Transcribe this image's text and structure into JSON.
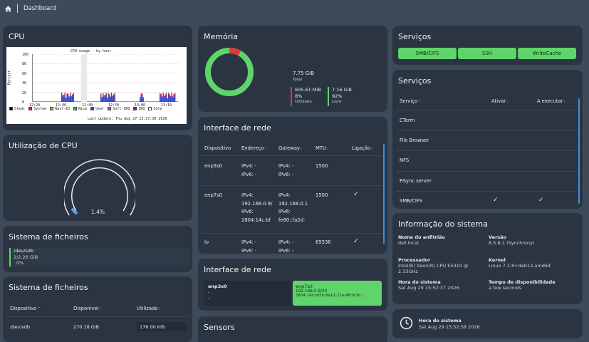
{
  "topbar": {
    "breadcrumb": "Dashboard"
  },
  "cpu": {
    "title": "CPU",
    "graph": {
      "title": "CPU usage - by hour",
      "ylabel": "Percent",
      "yticks": [
        "100",
        "80",
        "60",
        "40",
        "20",
        "0"
      ],
      "xticks": [
        "12:20",
        "12:40",
        "12:40",
        "12:50",
        "13:00",
        "13:10"
      ],
      "legend": [
        "Steal",
        "System",
        "Wait-IO",
        "Nice",
        "User",
        "Soft-IRQ",
        "IRQ",
        "Idle"
      ],
      "legend_colors": [
        "#000000",
        "#e41a1c",
        "#c8a22c",
        "#4daf4a",
        "#2d47d4",
        "#bf4fbf",
        "#6e2a8a",
        "#ffffff"
      ],
      "updated": "Last update: Thu Aug 27 13:17:30 2026"
    }
  },
  "cpu_util": {
    "title": "Utilização de CPU",
    "value": "1.4%",
    "fraction": 0.014
  },
  "fs1": {
    "title": "Sistema de ficheiros",
    "device": "/dev/sdb",
    "usage": "2/2.26 GiB",
    "percent": "0%"
  },
  "fs2": {
    "title": "Sistema de ficheiros",
    "headers": [
      "Dispositivo",
      "Disponível",
      "Utilizado"
    ],
    "row": {
      "device": "/dev/sdb",
      "available": "270.18 GiB",
      "used": "176.00 KiB"
    }
  },
  "memory": {
    "title": "Memória",
    "total_value": "7.75 GiB",
    "total_label": "Total",
    "used_value": "605.61 MiB",
    "used_pct": "8%",
    "used_label": "Utilizado",
    "free_value": "7.16 GiB",
    "free_pct": "92%",
    "free_label": "Livre",
    "used_fraction": 0.08,
    "colors": {
      "used": "#e03a3a",
      "free": "#5fd46b"
    }
  },
  "network": {
    "title": "Interface de rede",
    "headers": [
      "Dispositivo",
      "Endereço",
      "Gateway",
      "MTU",
      "Ligação"
    ],
    "rows": [
      {
        "device": "enp3s0",
        "addr1": "IPv4: -",
        "addr2": "IPv6: -",
        "addr3": "",
        "addr4": "",
        "gw1": "IPv4: -",
        "gw2": "IPv6: -",
        "gw3": "",
        "gw4": "",
        "mtu": "1500",
        "link": ""
      },
      {
        "device": "enp7s0",
        "addr1": "IPv4:",
        "addr2": "192.168.0.9/",
        "addr3": "IPv6:",
        "addr4": "2804:14c:bf",
        "gw1": "IPv4:",
        "gw2": "192.168.0.1",
        "gw3": "IPv6:",
        "gw4": "fe80::fa2d:",
        "mtu": "1500",
        "link": "✓"
      },
      {
        "device": "lo",
        "addr1": "IPv4: -",
        "addr2": "IPv6: -",
        "addr3": "",
        "addr4": "",
        "gw1": "IPv4: -",
        "gw2": "IPv6: -",
        "gw3": "",
        "gw4": "",
        "mtu": "65536",
        "link": "✓"
      }
    ]
  },
  "network2": {
    "title": "Interface de rede",
    "iface1": {
      "name": "enp3s0",
      "line1": "-",
      "line2": "-"
    },
    "iface2": {
      "name": "enp7s0",
      "line1": "192.168.0.9/24",
      "line2": "2804:14c:bf26:8a12:21e:4ff:fe1b..."
    }
  },
  "sensors": {
    "title": "Sensors"
  },
  "services_buttons": {
    "title": "Serviços",
    "buttons": [
      "SMB/CIFS",
      "SSH",
      "WriteCache"
    ]
  },
  "services_table": {
    "title": "Serviços",
    "headers": [
      "Serviço",
      "Ativar",
      "A executar"
    ],
    "rows": [
      {
        "name": "CTerm",
        "enabled": "",
        "running": ""
      },
      {
        "name": "File Browser",
        "enabled": "",
        "running": ""
      },
      {
        "name": "NFS",
        "enabled": "",
        "running": ""
      },
      {
        "name": "RSync server",
        "enabled": "",
        "running": ""
      },
      {
        "name": "SMB/CIFS",
        "enabled": "✓",
        "running": "✓"
      }
    ]
  },
  "sysinfo": {
    "title": "Informação do sistema",
    "hostname_label": "Nome do anfitrião",
    "hostname": "dell.local",
    "version_label": "Versão",
    "version": "8.5.8-1 (Synchrony)",
    "cpu_label": "Processador",
    "cpu": "Intel(R) Xeon(R) CPU E5410 @ 2.33GHz",
    "kernel_label": "Kernel",
    "kernel": "Linux 7.1.8+deb13-amd64",
    "time_label": "Hora do sistema",
    "time": "Sat Aug 29 15:52:37 2026",
    "uptime_label": "Tempo de disponibilidade",
    "uptime": "a few seconds"
  },
  "clock": {
    "label": "Hora do sistema",
    "time": "Sat Aug 29 15:52:38 2026"
  }
}
